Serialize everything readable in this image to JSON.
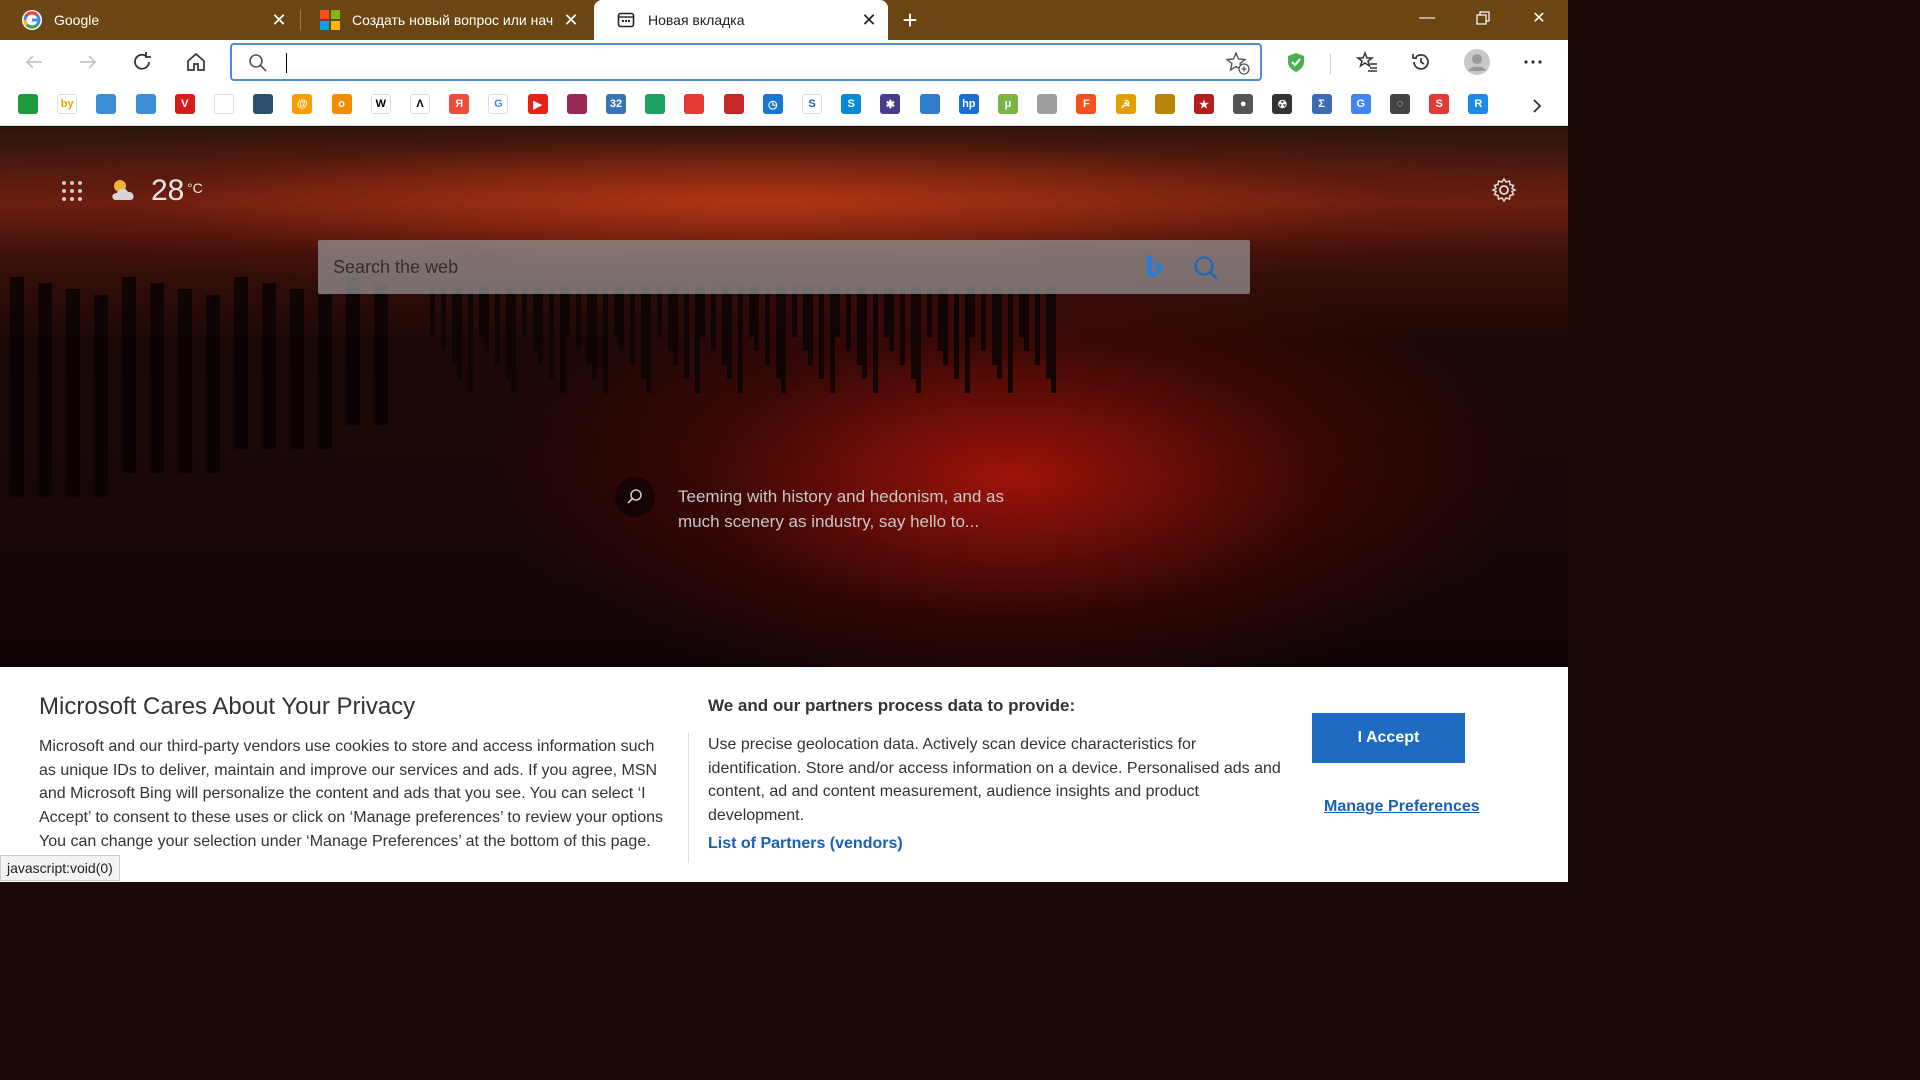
{
  "tabs": [
    {
      "title": "Google",
      "icon": "google-icon"
    },
    {
      "title": "Создать новый вопрос или нач",
      "icon": "microsoft-icon"
    },
    {
      "title": "Новая вкладка",
      "icon": "new-tab-page-icon",
      "active": true
    }
  ],
  "address": {
    "value": ""
  },
  "favorites_icons": [
    "shield-icon",
    "byfly-icon",
    "app-icon",
    "app-icon",
    "vivaldi-icon",
    "flag-icon",
    "app-icon",
    "mail-at-icon",
    "odnoklassniki-icon",
    "wikipedia-icon",
    "lambda-icon",
    "yandex-icon",
    "google-icon",
    "youtube-icon",
    "app-icon",
    "app-icon",
    "maps-pin-icon",
    "pin-icon",
    "app-icon",
    "clock-icon",
    "s-icon",
    "skype-icon",
    "gear-icon",
    "chart-icon",
    "hp-icon",
    "utorrent-icon",
    "app-icon",
    "app-icon",
    "star-icon",
    "app-icon",
    "app-icon",
    "app-icon",
    "radiation-icon",
    "sigma-icon",
    "translate-icon",
    "app-icon",
    "app-icon",
    "app-icon"
  ],
  "weather": {
    "temp": "28",
    "unit": "°C"
  },
  "search": {
    "placeholder": "Search the web"
  },
  "story": {
    "text": "Teeming with history and hedonism, and as much scenery as industry, say hello to..."
  },
  "privacy": {
    "title": "Microsoft Cares About Your Privacy",
    "body": "Microsoft and our third-party vendors use cookies to store and access information such as unique IDs to deliver, maintain and improve our services and ads. If you agree, MSN and Microsoft Bing will personalize the content and ads that you see. You can select ‘I Accept’ to consent to these uses or click on ‘Manage preferences’ to review your options You can change your selection under ‘Manage Preferences’ at the bottom of this page.",
    "purposes_heading": "We and our partners process data to provide:",
    "purposes_text": "Use precise geolocation data. Actively scan device characteristics for identification. Store and/or access information on a device. Personalised ads and content, ad and content measurement, audience insights and product development.",
    "partners_link": "List of Partners (vendors)",
    "accept_label": "I Accept",
    "manage_label": "Manage Preferences"
  },
  "status_bar": "javascript:void(0)",
  "colors": {
    "tabstrip": "#6b4512",
    "accent": "#1e6bc2",
    "link": "#1a5fb4"
  }
}
